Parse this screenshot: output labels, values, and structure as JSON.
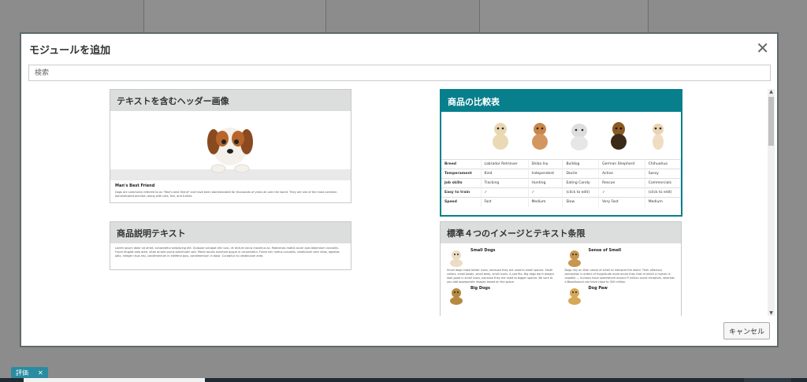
{
  "modal": {
    "title": "モジュールを追加",
    "search_placeholder": "検索",
    "cancel_label": "キャンセル"
  },
  "cards": {
    "header_image": {
      "title": "テキストを含むヘッダー画像",
      "heading": "Man's Best Friend",
      "text": "Dogs are commonly referred to as \"Man's best friend\" and have been domesticated for thousands of years all over the world. They are one of the most common domesticated animals, along with cats, fish, and turtles."
    },
    "comparison": {
      "title": "商品の比較表",
      "columns": [
        "Labrador Retriever",
        "Shiba Inu",
        "Bulldog",
        "German Shepherd",
        "Chihuahua"
      ],
      "rows": [
        {
          "label": "Breed",
          "cells": [
            "Labrador Retriever",
            "Shiba Inu",
            "Bulldog",
            "German Shepherd",
            "Chihuahua"
          ]
        },
        {
          "label": "Temperament",
          "cells": [
            "Kind",
            "Independent",
            "Docile",
            "Active",
            "Sassy"
          ]
        },
        {
          "label": "Job skills",
          "cells": [
            "Tracking",
            "Hunting",
            "Eating Candy",
            "Rescue",
            "Commercials"
          ]
        },
        {
          "label": "Easy to train",
          "cells": [
            "✓",
            "✓",
            "(click to edit)",
            "✓",
            "(click to edit)"
          ]
        },
        {
          "label": "Speed",
          "cells": [
            "Fast",
            "Medium",
            "Slow",
            "Very Fast",
            "Medium"
          ]
        }
      ]
    },
    "description": {
      "title": "商品説明テキスト",
      "text": "Lorem ipsum dolor sit amet, consectetur adipiscing elit. Quisque volutpat elit nunc, et dictum lacus maximus ac. Maecenas mattis acum quis bibendum convallis. Fusce feugiat odio ante, vitae ornare purus sollicitudin sed. Morbi iaculis euismod augue in consectetur. Fusce nec metus convallis, vestibulum sem vitae, egestas odio, integer risus nisl, condimentum in eleifend quis, condimentum in dolor. Curabitur eu vestibulum ante."
    },
    "four_images": {
      "title": "標準４つのイメージとテキスト条限",
      "items": [
        {
          "title": "Small Dogs",
          "text": "Small dogs make better icons, because they are used to small spaces. Small collars, small bowls, small beds, small icons. A just fits. Big dogs don't always look good in small icons, because they are used to bigger spaces. Be sure to you add appropriate images based on the space."
        },
        {
          "title": "Sense of Smell",
          "text": "Dogs rely on their sense of smell to interpret the world. Their olfactory perception is orders of magnitude more acute than that of which a human is capable — humans have somewhere around 5 million scent receptors, whereas a Bloodhound can have close to 300 million."
        },
        {
          "title": "Big Dogs",
          "text": ""
        },
        {
          "title": "Dog Paw",
          "text": ""
        }
      ]
    }
  },
  "taskbar": {
    "tag_label": "評価",
    "tag_close": "✕"
  },
  "colors": {
    "accent": "#087f8c",
    "card_header": "#dcdede"
  }
}
